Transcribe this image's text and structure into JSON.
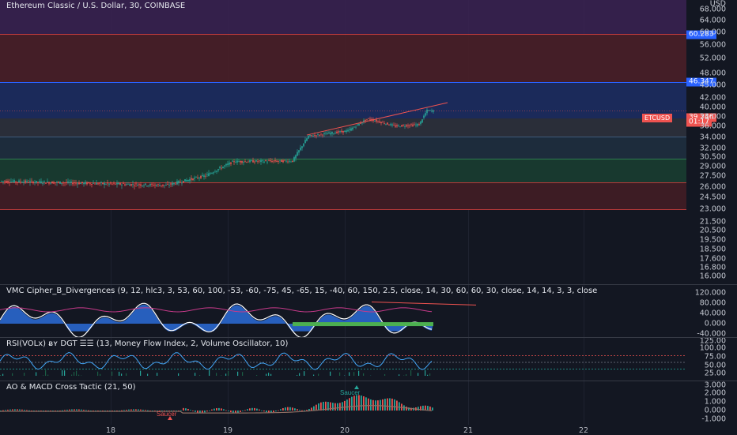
{
  "chart_title": "Ethereum Classic / U.S. Dollar, 30, COINBASE",
  "currency": "USD",
  "price_axis": [
    "68.000",
    "64.000",
    "60.000",
    "56.000",
    "52.000",
    "48.000",
    "45.000",
    "42.000",
    "40.000",
    "38.000",
    "36.000",
    "34.000",
    "32.000",
    "30.500",
    "29.000",
    "27.500",
    "26.000",
    "24.500",
    "23.000",
    "21.500",
    "20.500",
    "19.500",
    "18.500",
    "17.600",
    "16.800",
    "16.000"
  ],
  "price_tags": {
    "top": "60.283",
    "blue": "46.347",
    "last": "39.246",
    "ticker": "ETCUSD",
    "countdown": "01:17"
  },
  "indicators": {
    "vmc": {
      "title": "VMC Cipher_B_Divergences (9, 12, hlc3, 3, 53, 60, 100, -53, -60, -75, 45, -65, 15, -40, 60, 150, 2.5, close, 14, 30, 60, 60, 30, close, 14, 14, 3, 3, close",
      "axis": [
        "120.000",
        "80.000",
        "40.000",
        "0.000",
        "-40.000"
      ]
    },
    "rsi": {
      "title": "RSI(VOLx) ᴃʏ DGT ☰☰ (13, Money Flow Index, 2, Volume Oscillator, 10)",
      "axis": [
        "125.00",
        "100.00",
        "75.00",
        "50.00",
        "25.00"
      ]
    },
    "ao": {
      "title": "AO & MACD Cross Tactic (21, 50)",
      "axis": [
        "3.000",
        "2.000",
        "1.000",
        "0.000",
        "-1.000"
      ],
      "labels": [
        "Saucer",
        "Saucer"
      ]
    }
  },
  "time_axis": [
    "18",
    "19",
    "20",
    "21",
    "22"
  ],
  "colors": {
    "background": "#131722",
    "up": "#26a69a",
    "down": "#ef5350",
    "blue_line": "#2962ff"
  },
  "chart_data": {
    "type": "line",
    "title": "Ethereum Classic / U.S. Dollar, 30, COINBASE",
    "x": [
      "18",
      "19",
      "20"
    ],
    "series": [
      {
        "name": "ETCUSD",
        "values": [
          26.8,
          27.4,
          29.9,
          36.2,
          39.2
        ]
      }
    ],
    "ylim": [
      16.0,
      70.0
    ],
    "y_scale": "log",
    "last_value": 39.246,
    "levels": [
      60.283,
      46.347
    ]
  }
}
